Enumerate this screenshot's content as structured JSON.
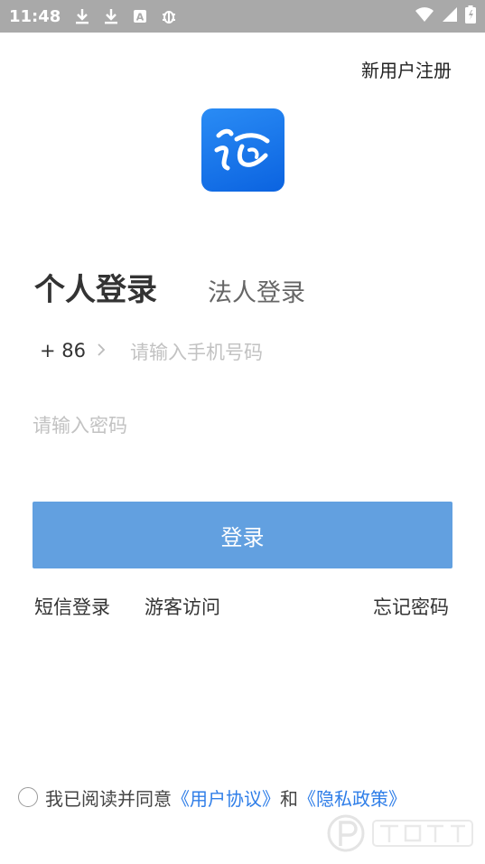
{
  "status_bar": {
    "time": "11:48",
    "icons": [
      "download-icon",
      "download-icon",
      "text-a-icon",
      "bug-icon"
    ],
    "right_icons": [
      "wifi-icon",
      "signal-icon",
      "battery-icon"
    ]
  },
  "header": {
    "register_label": "新用户注册"
  },
  "logo": {
    "icon": "app-logo-icon",
    "brand_color": "#1877ee"
  },
  "login_tabs": {
    "personal": "个人登录",
    "corporate": "法人登录",
    "active": "personal"
  },
  "phone": {
    "country_code": "+ 86",
    "placeholder": "请输入手机号码",
    "value": ""
  },
  "password": {
    "placeholder": "请输入密码",
    "value": ""
  },
  "login_button": {
    "label": "登录",
    "color": "#62a0e0"
  },
  "links": {
    "sms_login": "短信登录",
    "guest_visit": "游客访问",
    "forgot_password": "忘记密码"
  },
  "agreement": {
    "prefix": "我已阅读并同意",
    "user_agreement": "《用户协议》",
    "and": "和",
    "privacy_policy": "《隐私政策》",
    "checked": false,
    "link_color": "#2f7ee8"
  }
}
